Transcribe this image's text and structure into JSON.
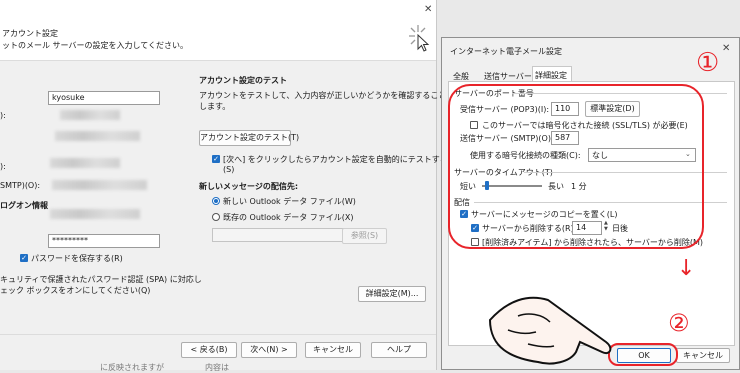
{
  "back": {
    "header_title": "アカウント設定",
    "header_sub": "ットのメール サーバーの設定を入力してください。",
    "left_labels": [
      "):",
      "):",
      "SMTP)(O):"
    ],
    "logon_label": "ログオン情報",
    "username_value": "kyosuke",
    "password_value": "*********",
    "remember_password": "パスワードを保存する(R)",
    "spa_line1": "キュリティで保護されたパスワード認証 (SPA) に対応し",
    "spa_line2": "ェック ボックスをオンにしてください(Q)",
    "test_title": "アカウント設定のテスト",
    "test_desc1": "アカウントをテストして、入力内容が正しいかどうかを確認することをお勧め",
    "test_desc2": "します。",
    "test_button": "アカウント設定のテスト(T)",
    "auto_test1": "[次へ] をクリックしたらアカウント設定を自動的にテストする",
    "auto_test2": "(S)",
    "deliver_title": "新しいメッセージの配信先:",
    "radio_new": "新しい Outlook データ ファイル(W)",
    "radio_existing": "既存の Outlook データ ファイル(X)",
    "browse": "参照(S)",
    "advanced": "詳細設定(M)...",
    "btn_back": "< 戻る(B)",
    "btn_next": "次へ(N) >",
    "btn_cancel": "キャンセル",
    "btn_help": "ヘルプ",
    "behind_text1": "に反映されますが",
    "behind_text2": "内容は"
  },
  "front": {
    "title": "インターネット電子メール設定",
    "close": "✕",
    "tabs": [
      "全般",
      "送信サーバー",
      "詳細設定"
    ],
    "port_group": "サーバーのポート番号",
    "incoming_label": "受信サーバー (POP3)(I):",
    "incoming_value": "110",
    "default_button": "標準設定(D)",
    "ssl_label": "このサーバーでは暗号化された接続 (SSL/TLS) が必要(E)",
    "outgoing_label": "送信サーバー (SMTP)(O):",
    "outgoing_value": "587",
    "encrypt_label": "使用する暗号化接続の種類(C):",
    "encrypt_value": "なし",
    "timeout_group": "サーバーのタイムアウト(T)",
    "timeout_short": "短い",
    "timeout_long": "長い",
    "timeout_value": "1 分",
    "timeout_level": 0.08,
    "delivery_group": "配信",
    "keep_copy": "サーバーにメッセージのコピーを置く(L)",
    "remove_after": "サーバーから削除する(R)",
    "days_value": "14",
    "days_unit": "日後",
    "remove_deleted": "[削除済みアイテム] から削除されたら、サーバーから削除(M)",
    "ok": "OK",
    "cancel": "キャンセル"
  },
  "annotations": {
    "circle1": "①",
    "circle2": "②",
    "arrow": "↓"
  },
  "colors": {
    "accent": "#1f6fc5",
    "annotation": "#e8242a"
  }
}
